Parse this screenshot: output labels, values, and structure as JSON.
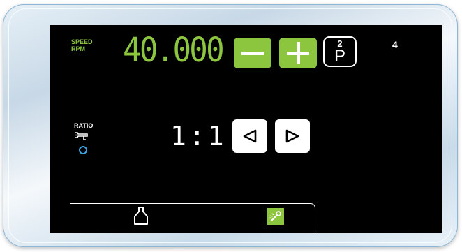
{
  "speed": {
    "label_line1": "SPEED",
    "label_line2": "RPM",
    "value": "40.000"
  },
  "controls": {
    "decrease_icon": "minus-icon",
    "increase_icon": "plus-icon"
  },
  "program": {
    "number": "2",
    "letter": "P"
  },
  "corner_number": "4",
  "ratio": {
    "label": "RATIO",
    "value": "1:1",
    "handpiece_icon": "handpiece-icon",
    "indicator_icon": "circle-icon",
    "prev_icon": "triangle-left-icon",
    "next_icon": "triangle-right-icon"
  },
  "bottom_bar": {
    "left_icon": "bottle-icon",
    "right_icon": "spray-wrench-icon"
  },
  "colors": {
    "accent_green": "#8cc63e",
    "screen_bg": "#000000",
    "indicator_blue": "#3aa6e0"
  }
}
